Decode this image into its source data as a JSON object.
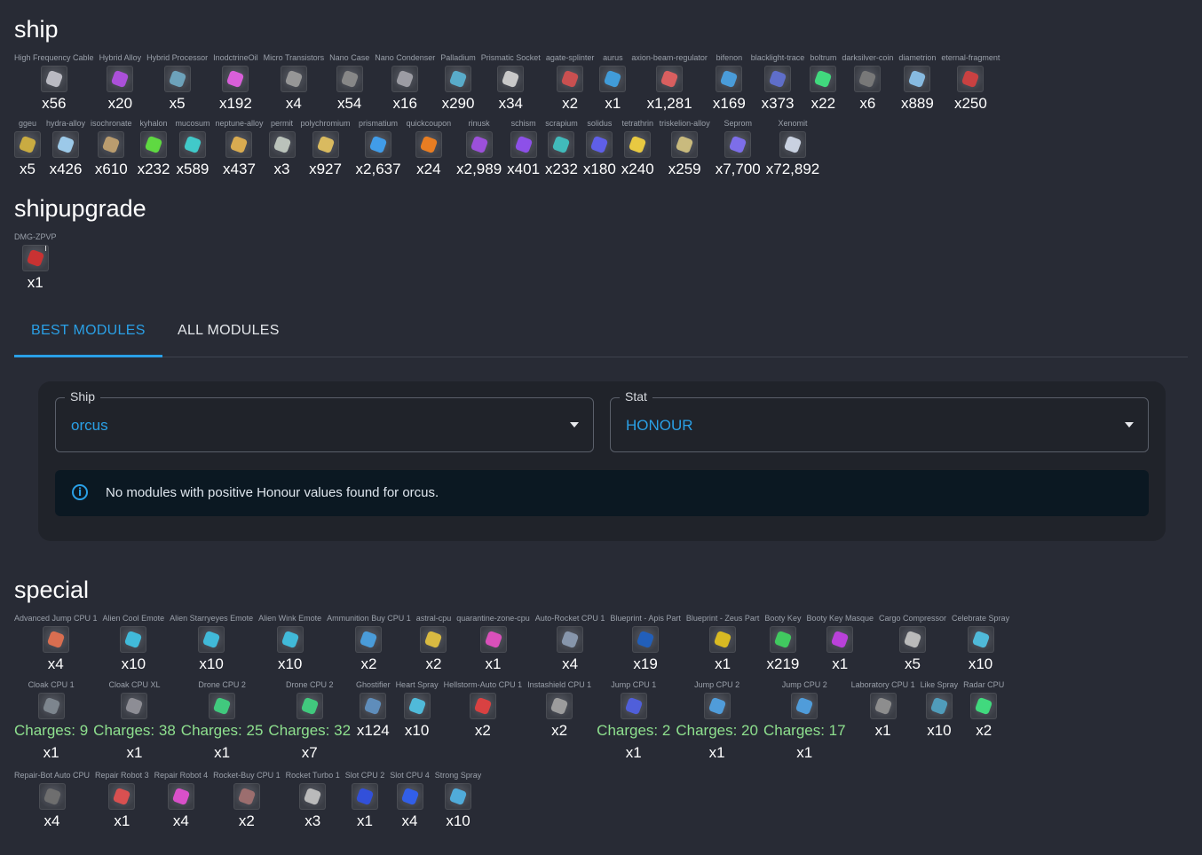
{
  "ship": {
    "title": "ship",
    "row1": [
      {
        "name": "High Frequency Cable",
        "count": "x56",
        "color": "#c0c0c8"
      },
      {
        "name": "Hybrid Alloy",
        "count": "x20",
        "color": "#b050e0"
      },
      {
        "name": "Hybrid Processor",
        "count": "x5",
        "color": "#6fa7c0"
      },
      {
        "name": "InodctrineOil",
        "count": "x192",
        "color": "#e060e0"
      },
      {
        "name": "Micro Transistors",
        "count": "x4",
        "color": "#9a9a9a"
      },
      {
        "name": "Nano Case",
        "count": "x54",
        "color": "#8a8a8a"
      },
      {
        "name": "Nano Condenser",
        "count": "x16",
        "color": "#a0a0a8"
      },
      {
        "name": "Palladium",
        "count": "x290",
        "color": "#5ab0d0"
      },
      {
        "name": "Prismatic Socket",
        "count": "x34",
        "color": "#d0d0d0"
      },
      {
        "name": "agate-splinter",
        "count": "x2",
        "color": "#d05050"
      },
      {
        "name": "aurus",
        "count": "x1",
        "color": "#40a0e0"
      },
      {
        "name": "axion-beam-regulator",
        "count": "x1,281",
        "color": "#e06060"
      },
      {
        "name": "bifenon",
        "count": "x169",
        "color": "#4aa0e0"
      },
      {
        "name": "blacklight-trace",
        "count": "x373",
        "color": "#6070d0"
      },
      {
        "name": "boltrum",
        "count": "x22",
        "color": "#40e080"
      },
      {
        "name": "darksilver-coin",
        "count": "x6",
        "color": "#7a7a7a"
      },
      {
        "name": "diametrion",
        "count": "x889",
        "color": "#8ac0e8"
      },
      {
        "name": "eternal-fragment",
        "count": "x250",
        "color": "#d04040"
      }
    ],
    "row2": [
      {
        "name": "ggeu",
        "count": "x5",
        "color": "#d0b040"
      },
      {
        "name": "hydra-alloy",
        "count": "x426",
        "color": "#a0d0f0"
      },
      {
        "name": "isochronate",
        "count": "x610",
        "color": "#c0a070"
      },
      {
        "name": "kyhalon",
        "count": "x232",
        "color": "#60e040"
      },
      {
        "name": "mucosum",
        "count": "x589",
        "color": "#40d0d0"
      },
      {
        "name": "neptune-alloy",
        "count": "x437",
        "color": "#e0b050"
      },
      {
        "name": "permit",
        "count": "x3",
        "color": "#c0c8c0"
      },
      {
        "name": "polychromium",
        "count": "x927",
        "color": "#e0c060"
      },
      {
        "name": "prismatium",
        "count": "x2,637",
        "color": "#40a0f0"
      },
      {
        "name": "quickcoupon",
        "count": "x24",
        "color": "#f08020"
      },
      {
        "name": "rinusk",
        "count": "x2,989",
        "color": "#a050e0"
      },
      {
        "name": "schism",
        "count": "x401",
        "color": "#9050f0"
      },
      {
        "name": "scrapium",
        "count": "x232",
        "color": "#40c0c0"
      },
      {
        "name": "solidus",
        "count": "x180",
        "color": "#6060f0"
      },
      {
        "name": "tetrathrin",
        "count": "x240",
        "color": "#f0d040"
      },
      {
        "name": "triskelion-alloy",
        "count": "x259",
        "color": "#d0c080"
      },
      {
        "name": "Seprom",
        "count": "x7,700",
        "color": "#8070f0"
      },
      {
        "name": "Xenomit",
        "count": "x72,892",
        "color": "#d0d8e8"
      }
    ]
  },
  "shipupgrade": {
    "title": "shipupgrade",
    "items": [
      {
        "name": "DMG-ZPVP",
        "count": "x1",
        "color": "#d03030",
        "badge": "I"
      }
    ]
  },
  "tabs": {
    "best": "BEST MODULES",
    "all": "ALL MODULES"
  },
  "filters": {
    "ship_label": "Ship",
    "ship_value": "orcus",
    "stat_label": "Stat",
    "stat_value": "HONOUR",
    "alert": "No modules with positive Honour values found for orcus."
  },
  "special": {
    "title": "special",
    "row1": [
      {
        "name": "Advanced Jump CPU 1",
        "count": "x4",
        "color": "#e07050"
      },
      {
        "name": "Alien Cool Emote",
        "count": "x10",
        "color": "#40c0e0"
      },
      {
        "name": "Alien Starryeyes Emote",
        "count": "x10",
        "color": "#40c0e0"
      },
      {
        "name": "Alien Wink Emote",
        "count": "x10",
        "color": "#40c0e0"
      },
      {
        "name": "Ammunition Buy CPU 1",
        "count": "x2",
        "color": "#4aa0e0"
      },
      {
        "name": "astral-cpu",
        "count": "x2",
        "color": "#e0c040"
      },
      {
        "name": "quarantine-zone-cpu",
        "count": "x1",
        "color": "#e050c0"
      },
      {
        "name": "Auto-Rocket CPU 1",
        "count": "x4",
        "color": "#8a9ab0"
      },
      {
        "name": "Blueprint - Apis Part",
        "count": "x19",
        "color": "#2060c0"
      },
      {
        "name": "Blueprint - Zeus Part",
        "count": "x1",
        "color": "#e0c020"
      },
      {
        "name": "Booty Key",
        "count": "x219",
        "color": "#40d060"
      },
      {
        "name": "Booty Key Masque",
        "count": "x1",
        "color": "#c040e0"
      },
      {
        "name": "Cargo Compressor",
        "count": "x5",
        "color": "#c0c0c0"
      },
      {
        "name": "Celebrate Spray",
        "count": "x10",
        "color": "#50c0e0"
      }
    ],
    "row2": [
      {
        "name": "Cloak CPU 1",
        "charges": "Charges: 9",
        "count": "x1",
        "color": "#808890"
      },
      {
        "name": "Cloak CPU XL",
        "charges": "Charges: 38",
        "count": "x1",
        "color": "#909098"
      },
      {
        "name": "Drone CPU 2",
        "charges": "Charges: 25",
        "count": "x1",
        "color": "#40d080"
      },
      {
        "name": "Drone CPU 2",
        "charges": "Charges: 32",
        "count": "x7",
        "color": "#40d080"
      },
      {
        "name": "Ghostifier",
        "charges": "",
        "count": "x124",
        "color": "#6090c0"
      },
      {
        "name": "Heart Spray",
        "charges": "",
        "count": "x10",
        "color": "#50c0e0"
      },
      {
        "name": "Hellstorm-Auto CPU 1",
        "charges": "",
        "count": "x2",
        "color": "#e04040"
      },
      {
        "name": "Instashield CPU 1",
        "charges": "",
        "count": "x2",
        "color": "#a0a0a0"
      },
      {
        "name": "Jump CPU 1",
        "charges": "Charges: 2",
        "count": "x1",
        "color": "#5060e0"
      },
      {
        "name": "Jump CPU 2",
        "charges": "Charges: 20",
        "count": "x1",
        "color": "#50a0e0"
      },
      {
        "name": "Jump CPU 2",
        "charges": "Charges: 17",
        "count": "x1",
        "color": "#50a0e0"
      },
      {
        "name": "Laboratory CPU 1",
        "charges": "",
        "count": "x1",
        "color": "#909090"
      },
      {
        "name": "Like Spray",
        "charges": "",
        "count": "x10",
        "color": "#50a0c0"
      },
      {
        "name": "Radar CPU",
        "charges": "",
        "count": "x2",
        "color": "#40e080"
      }
    ],
    "row3": [
      {
        "name": "Repair-Bot Auto CPU",
        "count": "x4",
        "color": "#707070"
      },
      {
        "name": "Repair Robot 3",
        "count": "x1",
        "color": "#e05050"
      },
      {
        "name": "Repair Robot 4",
        "count": "x4",
        "color": "#e050d0"
      },
      {
        "name": "Rocket-Buy CPU 1",
        "count": "x2",
        "color": "#a07070"
      },
      {
        "name": "Rocket Turbo 1",
        "count": "x3",
        "color": "#c0c0c0"
      },
      {
        "name": "Slot CPU 2",
        "count": "x1",
        "color": "#3050e0"
      },
      {
        "name": "Slot CPU 4",
        "count": "x4",
        "color": "#3060f0"
      },
      {
        "name": "Strong Spray",
        "count": "x10",
        "color": "#50b0e0"
      }
    ]
  }
}
